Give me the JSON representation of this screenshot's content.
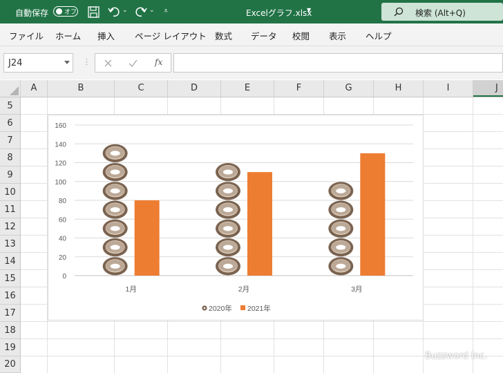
{
  "titlebar": {
    "autosave_label": "自動保存",
    "autosave_state": "オフ",
    "filename": "Excelグラフ.xlsx",
    "search_label": "検索 (Alt+Q)"
  },
  "menu": [
    "ファイル",
    "ホーム",
    "挿入",
    "ページ レイアウト",
    "数式",
    "データ",
    "校閲",
    "表示",
    "ヘルプ"
  ],
  "namebox": {
    "value": "J24"
  },
  "formula": {
    "fx_label": "fx"
  },
  "columns": [
    "A",
    "B",
    "C",
    "D",
    "E",
    "F",
    "G",
    "H",
    "I",
    "J"
  ],
  "rows": [
    "5",
    "6",
    "7",
    "8",
    "9",
    "10",
    "11",
    "12",
    "13",
    "14",
    "15",
    "16",
    "17",
    "18",
    "19",
    "20"
  ],
  "chart_data": {
    "type": "bar",
    "categories": [
      "1月",
      "2月",
      "3月"
    ],
    "series": [
      {
        "name": "2020年",
        "values": [
          140,
          120,
          100
        ],
        "fill": "donut-picture"
      },
      {
        "name": "2021年",
        "values": [
          80,
          110,
          130
        ],
        "color": "#ed7d31"
      }
    ],
    "ylim": [
      0,
      160
    ],
    "yticks": [
      0,
      20,
      40,
      60,
      80,
      100,
      120,
      140,
      160
    ],
    "grid": true,
    "legend": "bottom"
  },
  "watermark": "Buzzword Inc.",
  "colors": {
    "excel_green": "#217346",
    "orange": "#ed7d31",
    "donut": "#7a6350"
  }
}
